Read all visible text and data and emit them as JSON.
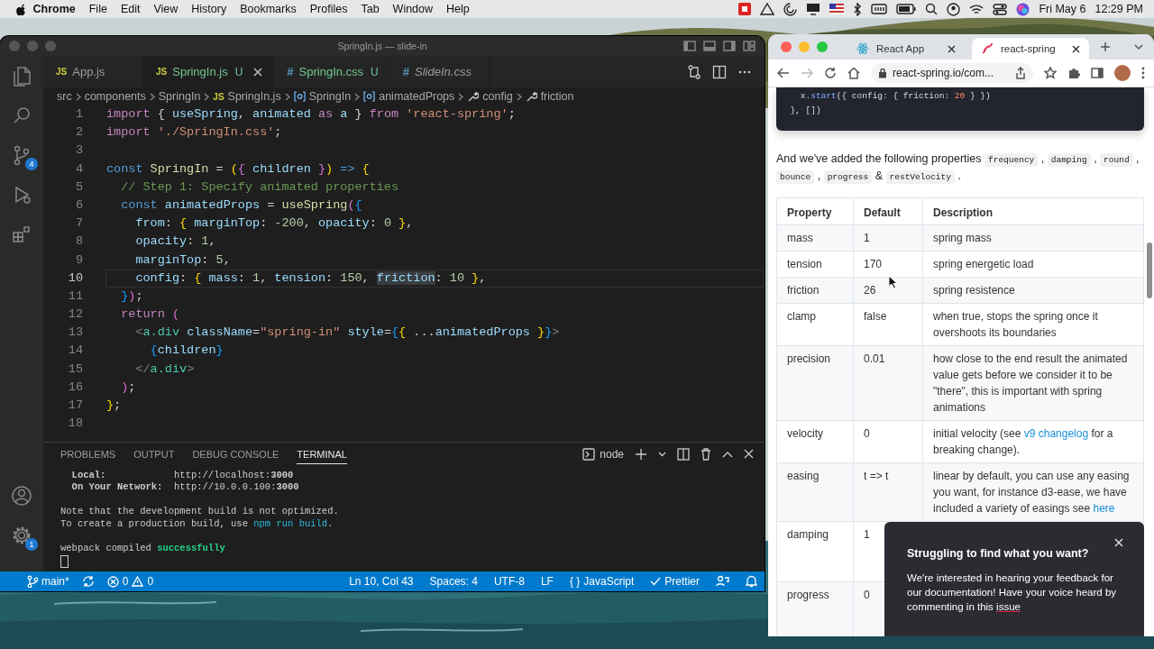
{
  "menubar": {
    "app": "Chrome",
    "menus": [
      "File",
      "Edit",
      "View",
      "History",
      "Bookmarks",
      "Profiles",
      "Tab",
      "Window",
      "Help"
    ],
    "date": "Fri May 6",
    "time": "12:29 PM"
  },
  "editor_window": {
    "title": "SpringIn.js — slide-in",
    "activity_items": [
      {
        "kind": "explorer"
      },
      {
        "kind": "search"
      },
      {
        "kind": "source-control",
        "badge": "4"
      },
      {
        "kind": "run"
      },
      {
        "kind": "extensions"
      }
    ],
    "activity_bottom": [
      {
        "kind": "account"
      },
      {
        "kind": "settings",
        "badge": "1"
      }
    ],
    "tabs": [
      {
        "icon": "JS",
        "kind": "js",
        "label": "App.js",
        "selected": false,
        "preview": false
      },
      {
        "icon": "JS",
        "kind": "js",
        "label": "SpringIn.js",
        "badge": "U",
        "selected": true,
        "preview": false
      },
      {
        "icon": "#",
        "kind": "css",
        "label": "SpringIn.css",
        "badge": "U",
        "selected": false,
        "preview": false
      },
      {
        "icon": "#",
        "kind": "css",
        "label": "SlideIn.css",
        "selected": false,
        "preview": true
      }
    ],
    "breadcrumb": [
      {
        "kind": "folder",
        "label": "src"
      },
      {
        "kind": "folder",
        "label": "components"
      },
      {
        "kind": "folder",
        "label": "SpringIn"
      },
      {
        "kind": "file",
        "icon": "JS",
        "label": "SpringIn.js"
      },
      {
        "kind": "symbol",
        "label": "SpringIn"
      },
      {
        "kind": "symbol",
        "label": "animatedProps"
      },
      {
        "kind": "property",
        "label": "config"
      },
      {
        "kind": "property",
        "label": "friction"
      }
    ],
    "code_lines": [
      {
        "number": "1",
        "current": false,
        "tokens": [
          {
            "text": "import",
            "kind": "ctrl"
          },
          {
            "text": " { ",
            "kind": "pun"
          },
          {
            "text": "useSpring",
            "kind": "var"
          },
          {
            "text": ", ",
            "kind": "pun"
          },
          {
            "text": "animated",
            "kind": "var"
          },
          {
            "text": " as ",
            "kind": "ctrl"
          },
          {
            "text": "a",
            "kind": "var"
          },
          {
            "text": " } ",
            "kind": "pun"
          },
          {
            "text": "from",
            "kind": "ctrl"
          },
          {
            "text": " 'react-spring'",
            "kind": "str"
          },
          {
            "text": ";",
            "kind": "pun"
          }
        ]
      },
      {
        "number": "2",
        "current": false,
        "tokens": [
          {
            "text": "import",
            "kind": "ctrl"
          },
          {
            "text": " './SpringIn.css'",
            "kind": "str"
          },
          {
            "text": ";",
            "kind": "pun"
          }
        ]
      },
      {
        "number": "3",
        "current": false
      },
      {
        "number": "4",
        "current": false,
        "tokens": [
          {
            "text": "const",
            "kind": "kw"
          },
          {
            "text": " SpringIn",
            "kind": "fn"
          },
          {
            "text": " = ",
            "kind": "pun"
          },
          {
            "text": "(",
            "kind": "b1"
          },
          {
            "text": "{",
            "kind": "b2"
          },
          {
            "text": " children ",
            "kind": "var"
          },
          {
            "text": "}",
            "kind": "b2"
          },
          {
            "text": ")",
            "kind": "b1"
          },
          {
            "text": " =>",
            "kind": "kw"
          },
          {
            "text": " {",
            "kind": "b1"
          }
        ]
      },
      {
        "number": "5",
        "current": false,
        "tokens": [
          {
            "text": "  // Step 1: Specify animated properties",
            "kind": "cm"
          }
        ]
      },
      {
        "number": "6",
        "current": false,
        "tokens": [
          {
            "text": "  const",
            "kind": "kw"
          },
          {
            "text": " animatedProps",
            "kind": "var"
          },
          {
            "text": " = ",
            "kind": "pun"
          },
          {
            "text": "useSpring",
            "kind": "fn"
          },
          {
            "text": "(",
            "kind": "b2"
          },
          {
            "text": "{",
            "kind": "b3"
          }
        ]
      },
      {
        "number": "7",
        "current": false,
        "tokens": [
          {
            "text": "    from",
            "kind": "prop"
          },
          {
            "text": ": ",
            "kind": "pun"
          },
          {
            "text": "{",
            "kind": "b1"
          },
          {
            "text": " marginTop",
            "kind": "prop"
          },
          {
            "text": ": ",
            "kind": "pun"
          },
          {
            "text": "-200",
            "kind": "num"
          },
          {
            "text": ", ",
            "kind": "pun"
          },
          {
            "text": "opacity",
            "kind": "prop"
          },
          {
            "text": ": ",
            "kind": "pun"
          },
          {
            "text": "0",
            "kind": "num"
          },
          {
            "text": " }",
            "kind": "b1"
          },
          {
            "text": ",",
            "kind": "pun"
          }
        ]
      },
      {
        "number": "8",
        "current": false,
        "tokens": [
          {
            "text": "    opacity",
            "kind": "prop"
          },
          {
            "text": ": ",
            "kind": "pun"
          },
          {
            "text": "1",
            "kind": "num"
          },
          {
            "text": ",",
            "kind": "pun"
          }
        ]
      },
      {
        "number": "9",
        "current": false,
        "tokens": [
          {
            "text": "    marginTop",
            "kind": "prop"
          },
          {
            "text": ": ",
            "kind": "pun"
          },
          {
            "text": "5",
            "kind": "num"
          },
          {
            "text": ",",
            "kind": "pun"
          }
        ]
      },
      {
        "number": "10",
        "current": true,
        "tokens": [
          {
            "text": "    config",
            "kind": "prop"
          },
          {
            "text": ": ",
            "kind": "pun"
          },
          {
            "text": "{",
            "kind": "b1"
          },
          {
            "text": " mass",
            "kind": "prop"
          },
          {
            "text": ": ",
            "kind": "pun"
          },
          {
            "text": "1",
            "kind": "num"
          },
          {
            "text": ", ",
            "kind": "pun"
          },
          {
            "text": "tension",
            "kind": "prop"
          },
          {
            "text": ": ",
            "kind": "pun"
          },
          {
            "text": "150",
            "kind": "num"
          },
          {
            "text": ", ",
            "kind": "pun"
          },
          {
            "text": "friction",
            "kind": "match"
          },
          {
            "text": ": ",
            "kind": "pun"
          },
          {
            "text": "10",
            "kind": "num"
          },
          {
            "text": " }",
            "kind": "b1"
          },
          {
            "text": ",",
            "kind": "pun"
          }
        ]
      },
      {
        "number": "11",
        "current": false,
        "tokens": [
          {
            "text": "  }",
            "kind": "b3"
          },
          {
            "text": ")",
            "kind": "b2"
          },
          {
            "text": ";",
            "kind": "pun"
          }
        ]
      },
      {
        "number": "12",
        "current": false,
        "tokens": [
          {
            "text": "  return",
            "kind": "ctrl"
          },
          {
            "text": " (",
            "kind": "b2"
          }
        ]
      },
      {
        "number": "13",
        "current": false,
        "tokens": [
          {
            "text": "    <",
            "kind": "angle"
          },
          {
            "text": "a.div",
            "kind": "tag"
          },
          {
            "text": " className",
            "kind": "prop"
          },
          {
            "text": "=",
            "kind": "pun"
          },
          {
            "text": "\"spring-in\"",
            "kind": "str"
          },
          {
            "text": " style",
            "kind": "prop"
          },
          {
            "text": "=",
            "kind": "pun"
          },
          {
            "text": "{",
            "kind": "b3"
          },
          {
            "text": "{",
            "kind": "b1"
          },
          {
            "text": " ...",
            "kind": "pun"
          },
          {
            "text": "animatedProps",
            "kind": "var"
          },
          {
            "text": " }",
            "kind": "b1"
          },
          {
            "text": "}",
            "kind": "b3"
          },
          {
            "text": ">",
            "kind": "angle"
          }
        ]
      },
      {
        "number": "14",
        "current": false,
        "tokens": [
          {
            "text": "      {",
            "kind": "b3"
          },
          {
            "text": "children",
            "kind": "var"
          },
          {
            "text": "}",
            "kind": "b3"
          }
        ]
      },
      {
        "number": "15",
        "current": false,
        "tokens": [
          {
            "text": "    </",
            "kind": "angle"
          },
          {
            "text": "a.div",
            "kind": "tag"
          },
          {
            "text": ">",
            "kind": "angle"
          }
        ]
      },
      {
        "number": "16",
        "current": false,
        "tokens": [
          {
            "text": "  )",
            "kind": "b2"
          },
          {
            "text": ";",
            "kind": "pun"
          }
        ]
      },
      {
        "number": "17",
        "current": false,
        "tokens": [
          {
            "text": "}",
            "kind": "b1"
          },
          {
            "text": ";",
            "kind": "pun"
          }
        ]
      },
      {
        "number": "18",
        "current": false
      }
    ],
    "panel": {
      "tabs": [
        {
          "label": "PROBLEMS",
          "selected": false
        },
        {
          "label": "OUTPUT",
          "selected": false
        },
        {
          "label": "DEBUG CONSOLE",
          "selected": false
        },
        {
          "label": "TERMINAL",
          "selected": true
        }
      ],
      "terminal_name": "node",
      "terminal_blocks": [
        [
          [
            {
              "text": "  Local:",
              "kind": "bold"
            },
            {
              "text": "            http://localhost:",
              "kind": "text"
            },
            {
              "text": "3000",
              "kind": "bold"
            }
          ],
          [
            {
              "text": "  On Your Network:",
              "kind": "bold"
            },
            {
              "text": "  http://10.0.0.100:",
              "kind": "text"
            },
            {
              "text": "3000",
              "kind": "bold"
            }
          ]
        ],
        [
          [
            {
              "text": "Note that the development build is not optimized.",
              "kind": "text"
            }
          ],
          [
            {
              "text": "To create a production build, use ",
              "kind": "text"
            },
            {
              "text": "npm run build",
              "kind": "cmd"
            },
            {
              "text": ".",
              "kind": "text"
            }
          ]
        ],
        [
          [
            {
              "text": "webpack compiled ",
              "kind": "text"
            },
            {
              "text": "successfully",
              "kind": "success"
            }
          ]
        ]
      ]
    },
    "status_bar": {
      "branch": "main*",
      "errors": "0",
      "warnings": "0",
      "items": [
        "Ln 10, Col 43",
        "Spaces: 4",
        "UTF-8",
        "LF"
      ],
      "language_icon": "{ }",
      "language": "JavaScript",
      "formatter": "Prettier"
    }
  },
  "browser_window": {
    "tabs": [
      {
        "title": "React App",
        "kind": "react",
        "selected": false
      },
      {
        "title": "react-spring",
        "kind": "spring",
        "selected": true
      }
    ],
    "url": "react-spring.io/com...",
    "code_block": [
      [
        {
          "text": "    x.",
          "kind": "pun"
        },
        {
          "text": "start",
          "kind": "fn"
        },
        {
          "text": "({ config: { friction: ",
          "kind": "pun"
        },
        {
          "text": "20",
          "kind": "num"
        },
        {
          "text": " } })",
          "kind": "pun"
        }
      ],
      [
        {
          "text": "  }, [])",
          "kind": "pun"
        }
      ]
    ],
    "intro": [
      {
        "text": "And we've added the following properties ",
        "kind": "text"
      },
      {
        "text": "frequency",
        "kind": "code"
      },
      {
        "text": " , ",
        "kind": "text"
      },
      {
        "text": "damping",
        "kind": "code"
      },
      {
        "text": " , ",
        "kind": "text"
      },
      {
        "text": "round",
        "kind": "code"
      },
      {
        "text": " , ",
        "kind": "text"
      },
      {
        "text": "bounce",
        "kind": "code"
      },
      {
        "text": " , ",
        "kind": "text"
      },
      {
        "text": "progress",
        "kind": "code"
      },
      {
        "text": " & ",
        "kind": "text"
      },
      {
        "text": "restVelocity",
        "kind": "code"
      },
      {
        "text": " .",
        "kind": "text"
      }
    ],
    "table": {
      "columns": [
        "Property",
        "Default",
        "Description"
      ],
      "rows": [
        {
          "property": "mass",
          "default": "1",
          "description": [
            {
              "text": "spring mass",
              "kind": "text"
            }
          ]
        },
        {
          "property": "tension",
          "default": "170",
          "description": [
            {
              "text": "spring energetic load",
              "kind": "text"
            }
          ]
        },
        {
          "property": "friction",
          "default": "26",
          "description": [
            {
              "text": "spring resistence",
              "kind": "text"
            }
          ]
        },
        {
          "property": "clamp",
          "default": "false",
          "description": [
            {
              "text": "when true, stops the spring once it overshoots its boundaries",
              "kind": "text"
            }
          ]
        },
        {
          "property": "precision",
          "default": "0.01",
          "description": [
            {
              "text": "how close to the end result the animated value gets before we consider it to be \"there\", this is important with spring animations",
              "kind": "text"
            }
          ]
        },
        {
          "property": "velocity",
          "default": "0",
          "description": [
            {
              "text": "initial velocity (see ",
              "kind": "text"
            },
            {
              "text": "v9 changelog",
              "kind": "link"
            },
            {
              "text": " for a breaking change).",
              "kind": "text"
            }
          ]
        },
        {
          "property": "easing",
          "default": "t => t",
          "description": [
            {
              "text": "linear by default, you can use any easing you want, for instance d3-ease, we have included a variety of easings see ",
              "kind": "text"
            },
            {
              "text": "here",
              "kind": "link"
            }
          ]
        },
        {
          "property": "damping",
          "default": "1"
        },
        {
          "property": "progress",
          "default": "0"
        }
      ]
    },
    "toast": {
      "title": "Struggling to find what you want?",
      "body": [
        {
          "text": "We're interested in hearing your feedback for our documentation! Have your voice heard by commenting in this ",
          "kind": "text"
        },
        {
          "text": "issue",
          "kind": "link"
        }
      ]
    }
  }
}
